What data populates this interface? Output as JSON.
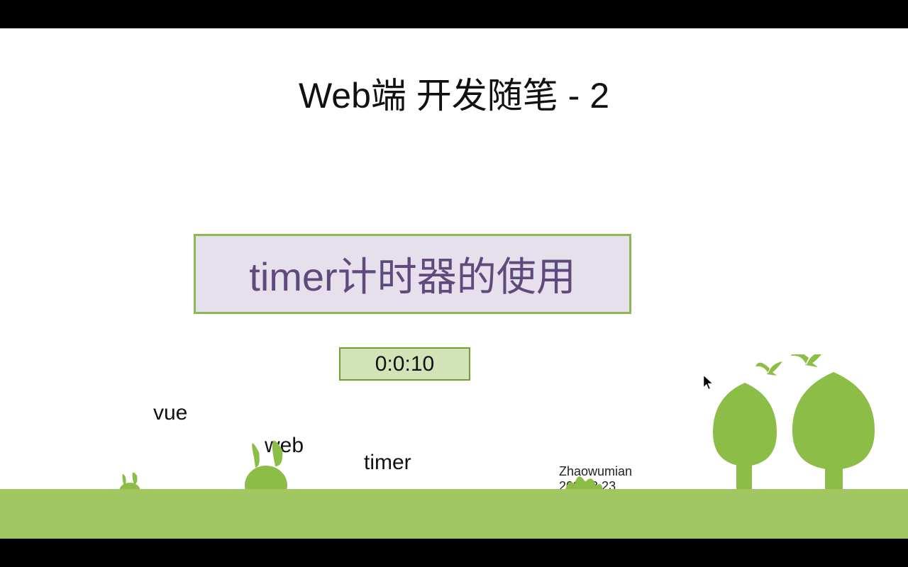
{
  "title": "Web端 开发随笔 - 2",
  "main_box": "timer计时器的使用",
  "timer_value": "0:0:10",
  "tags": {
    "vue": "vue",
    "web": "web",
    "timer": "timer"
  },
  "author": {
    "name": "Zhaowumian",
    "date": "2023.3.23"
  }
}
